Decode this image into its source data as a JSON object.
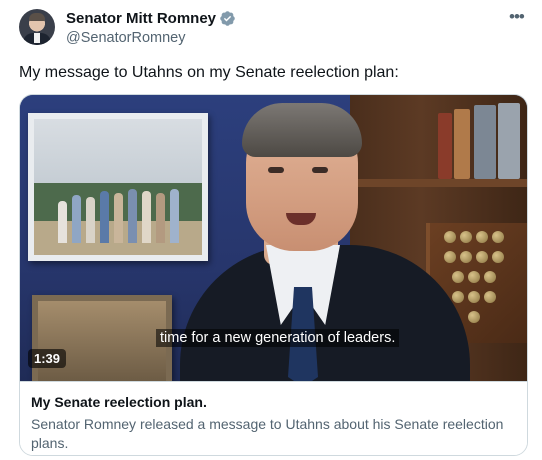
{
  "author": {
    "display_name": "Senator Mitt Romney",
    "handle": "@SenatorRomney",
    "verified_badge_color": "#829aab"
  },
  "post": {
    "text": "My message to Utahns on my Senate reelection plan:"
  },
  "video": {
    "caption": "time for a new generation of leaders.",
    "duration": "1:39"
  },
  "card": {
    "title": "My Senate reelection plan.",
    "description": "Senator Romney released a message to Utahns about his Senate reelection plans."
  },
  "icons": {
    "more": "more-options-icon",
    "verified": "verified-badge-icon"
  }
}
